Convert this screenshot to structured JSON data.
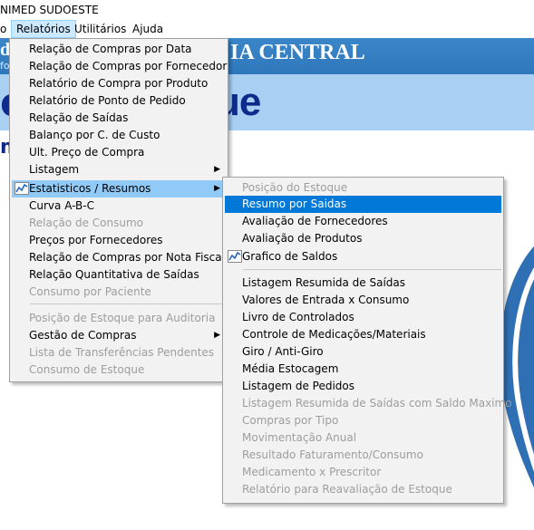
{
  "title": "NIMED SUDOESTE",
  "menubar": [
    "o",
    "Relatórios",
    "Utilitários",
    "Ajuda"
  ],
  "banner": {
    "title": "IA CENTRAL",
    "left_big": "d",
    "left_small": "fo",
    "big": "ue",
    "left_letter": "o",
    "m": "m"
  },
  "relatorios_menu": [
    {
      "label": "Relação de Compras por Data",
      "disabled": false
    },
    {
      "label": "Relação de Compras por Fornecedor",
      "disabled": false
    },
    {
      "label": "Relatório de Compra por Produto",
      "disabled": false
    },
    {
      "label": "Relatório de Ponto de Pedido",
      "disabled": false
    },
    {
      "label": "Relação de Saídas",
      "disabled": false
    },
    {
      "label": "Balanço por C. de Custo",
      "disabled": false
    },
    {
      "label": "Ult. Preço de Compra",
      "disabled": false
    },
    {
      "label": "Listagem",
      "disabled": false,
      "submenu": true
    },
    {
      "label": "Estatisticos / Resumos",
      "disabled": false,
      "submenu": true,
      "highlighted": true
    },
    {
      "label": "Curva A-B-C",
      "disabled": false
    },
    {
      "label": "Relação de Consumo",
      "disabled": true
    },
    {
      "label": "Preços por Fornecedores",
      "disabled": false
    },
    {
      "label": "Relação de Compras por Nota Fiscal",
      "disabled": false
    },
    {
      "label": "Relação Quantitativa de Saídas",
      "disabled": false
    },
    {
      "label": "Consumo por Paciente",
      "disabled": true
    },
    {
      "label": "Posição de Estoque para Auditoria",
      "disabled": true
    },
    {
      "label": "Gestão de Compras",
      "disabled": false,
      "submenu": true
    },
    {
      "label": "Lista de Transferências Pendentes",
      "disabled": true
    },
    {
      "label": "Consumo de Estoque",
      "disabled": true
    }
  ],
  "estatisticos_menu": [
    {
      "label": "Posição do Estoque",
      "disabled": true
    },
    {
      "label": "Resumo por Saidas",
      "disabled": false,
      "selected": true
    },
    {
      "label": "Avaliação de Fornecedores",
      "disabled": false
    },
    {
      "label": "Avaliação de Produtos",
      "disabled": false
    },
    {
      "label": "Grafico de Saldos",
      "disabled": false
    },
    {
      "label": "Listagem Resumida de Saídas",
      "disabled": false
    },
    {
      "label": "Valores de Entrada x Consumo",
      "disabled": false
    },
    {
      "label": "Livro de Controlados",
      "disabled": false
    },
    {
      "label": "Controle de Medicações/Materiais",
      "disabled": false
    },
    {
      "label": "Giro / Anti-Giro",
      "disabled": false
    },
    {
      "label": "Média Estocagem",
      "disabled": false
    },
    {
      "label": "Listagem de Pedidos",
      "disabled": false
    },
    {
      "label": "Listagem Resumida de Saídas com Saldo Maximo",
      "disabled": true
    },
    {
      "label": "Compras por Tipo",
      "disabled": true
    },
    {
      "label": "Movimentação Anual",
      "disabled": true
    },
    {
      "label": "Resultado Faturamento/Consumo",
      "disabled": true
    },
    {
      "label": "Medicamento x Prescritor",
      "disabled": true
    },
    {
      "label": "Relatório para Reavaliação de Estoque",
      "disabled": true
    }
  ],
  "colors": {
    "selected": "#0078d7",
    "highlight": "#91c9f7",
    "banner": "#3a86c8",
    "banner2": "#a9cff2"
  }
}
